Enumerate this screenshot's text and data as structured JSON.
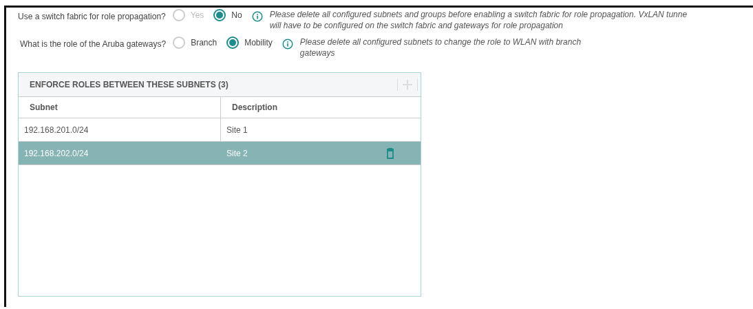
{
  "questions": [
    {
      "label": "Use a switch fabric for role propagation?",
      "options": [
        {
          "label": "Yes",
          "selected": false,
          "disabled": true
        },
        {
          "label": "No",
          "selected": true,
          "disabled": false
        }
      ],
      "note_lines": [
        "Please delete all configured subnets and groups before enabling a switch fabric for role propagation. VxLAN tunne",
        "will have to be configured on the switch fabric and gateways for role propagation"
      ]
    },
    {
      "label": "What is the role of the Aruba gateways?",
      "options": [
        {
          "label": "Branch",
          "selected": false,
          "disabled": false
        },
        {
          "label": "Mobility",
          "selected": true,
          "disabled": false
        }
      ],
      "note_lines": [
        "Please delete all configured subnets to change the role to WLAN with branch",
        "gateways"
      ]
    }
  ],
  "table": {
    "title": "ENFORCE ROLES BETWEEN THESE SUBNETS (3)",
    "add_disabled": true,
    "columns": [
      "Subnet",
      "Description"
    ],
    "rows": [
      {
        "cells": [
          "192.168.201.0/24",
          "Site 1"
        ],
        "selected": false
      },
      {
        "cells": [
          "192.168.202.0/24",
          "Site 2"
        ],
        "selected": true
      }
    ]
  }
}
